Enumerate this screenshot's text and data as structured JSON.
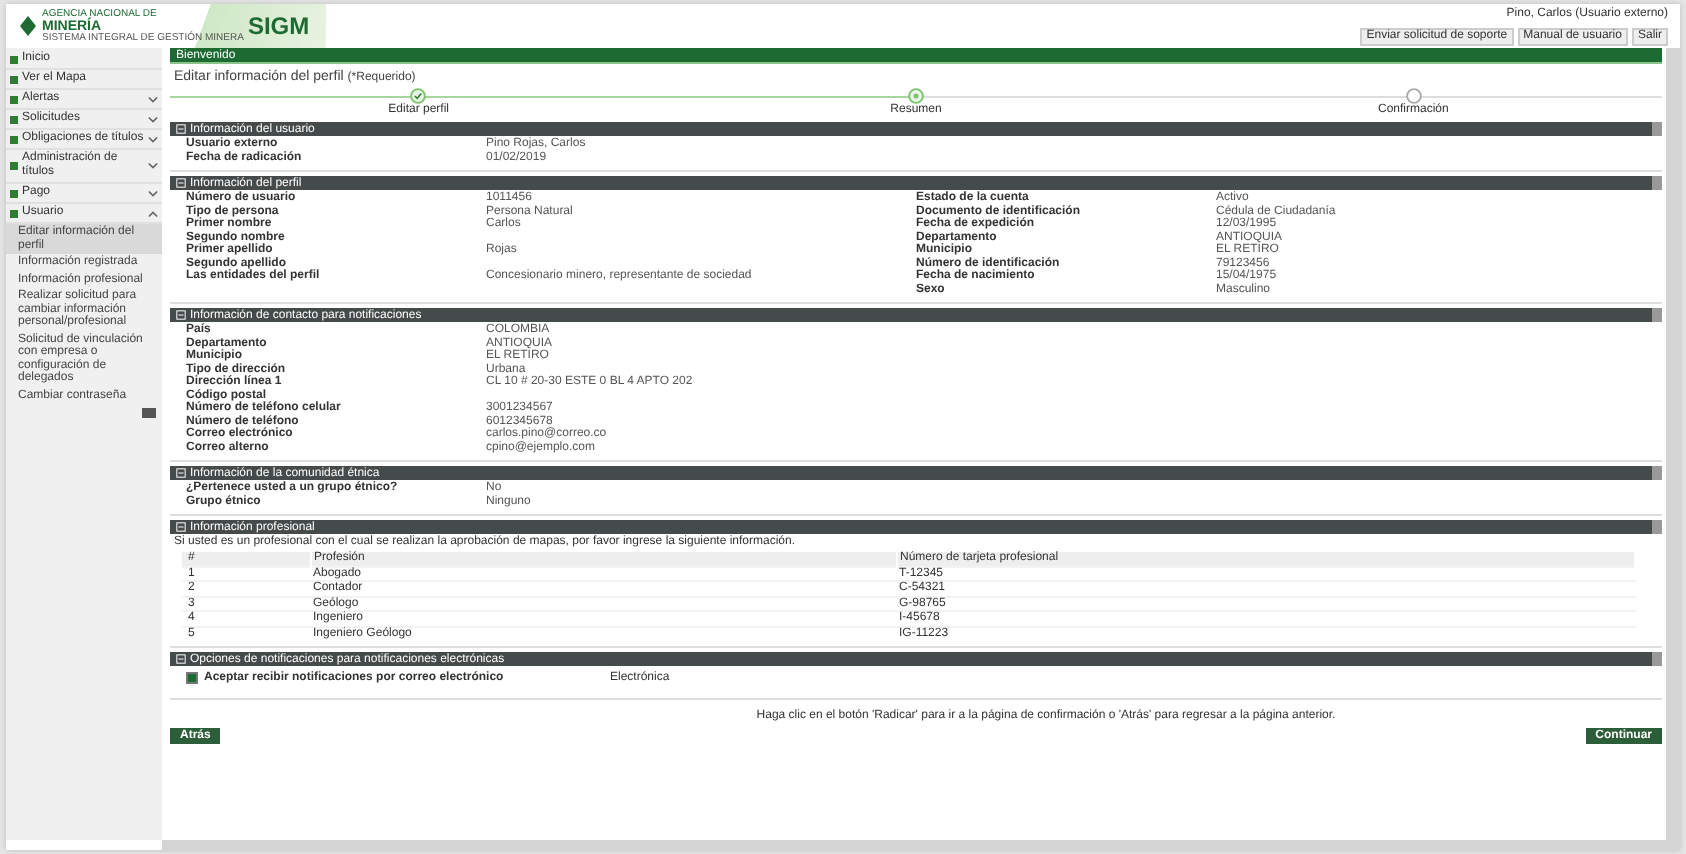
{
  "header": {
    "logo_top": "AGENCIA NACIONAL DE",
    "logo_main": "MINERÍA",
    "logo_brand": "SIGM",
    "logo_sub": "SISTEMA INTEGRAL DE GESTIÓN MINERA",
    "user": "Pino, Carlos (Usuario externo)",
    "buttons": [
      "Enviar solicitud de soporte",
      "Manual de usuario",
      "Salir"
    ]
  },
  "sidebar": {
    "items": [
      {
        "label": "Inicio",
        "kind": "link"
      },
      {
        "label": "Ver el Mapa",
        "kind": "link"
      },
      {
        "label": "Alertas",
        "kind": "menu",
        "expanded": false
      },
      {
        "label": "Solicitudes",
        "kind": "menu",
        "expanded": false
      },
      {
        "label": "Obligaciones de títulos",
        "kind": "menu",
        "expanded": false
      },
      {
        "label": "Administración de títulos",
        "kind": "menu",
        "expanded": false
      },
      {
        "label": "Pago",
        "kind": "menu",
        "expanded": false
      },
      {
        "label": "Usuario",
        "kind": "menu",
        "expanded": true,
        "children": [
          {
            "label": "Editar información del perfil",
            "selected": true
          },
          {
            "label": "Información registrada",
            "selected": false
          },
          {
            "label": "Información profesional",
            "selected": false
          },
          {
            "label": "Realizar solicitud para cambiar información personal/profesional",
            "selected": false
          },
          {
            "label": "Solicitud de vinculación con empresa o configuración de delegados",
            "selected": false
          },
          {
            "label": "Cambiar contraseña",
            "selected": false
          }
        ]
      }
    ]
  },
  "breadcrumb": "Bienvenido",
  "page": {
    "title": "Editar información del perfil",
    "required": "(*Requerido)"
  },
  "steps": [
    {
      "label": "Editar perfil",
      "completed": true,
      "selected": false
    },
    {
      "label": "Resumen",
      "completed": false,
      "selected": true
    },
    {
      "label": "Confirmación",
      "completed": false,
      "selected": false
    }
  ],
  "sections": [
    {
      "title": "Información del usuario",
      "kind": "fields",
      "left": [
        {
          "label": "Usuario externo",
          "value": "Pino Rojas, Carlos"
        },
        {
          "label": "Fecha de radicación",
          "value": "01/02/2019"
        }
      ]
    },
    {
      "title": "Información del perfil",
      "kind": "fields",
      "left": [
        {
          "label": "Número de usuario",
          "value": "1011456"
        },
        {
          "label": "Tipo de persona",
          "value": "Persona Natural"
        },
        {
          "label": "Primer nombre",
          "value": "Carlos"
        },
        {
          "label": "Segundo nombre"
        },
        {
          "label": "Primer apellido",
          "value": "Rojas"
        },
        {
          "label": "Segundo apellido"
        },
        {
          "label": "Las entidades del perfil",
          "value": "Concesionario minero, representante de sociedad"
        }
      ],
      "right": [
        {
          "label": "Estado de la cuenta",
          "value": "Activo"
        },
        {
          "label": "Documento de identificación",
          "value": "Cédula de Ciudadanía"
        },
        {
          "label": "Fecha de expedición",
          "value": "12/03/1995"
        },
        {
          "label": "Departamento",
          "value": "ANTIOQUIA"
        },
        {
          "label": "Municipio",
          "value": "EL RETIRO"
        },
        {
          "label": "Número de identificación",
          "value": "79123456"
        },
        {
          "label": "Fecha de nacimiento",
          "value": "15/04/1975"
        },
        {
          "label": "Sexo",
          "value": "Masculino"
        }
      ]
    },
    {
      "title": "Información de contacto para notificaciones",
      "kind": "fields",
      "left": [
        {
          "label": "País",
          "value": "COLOMBIA"
        },
        {
          "label": "Departamento",
          "value": "ANTIOQUIA"
        },
        {
          "label": "Municipio",
          "value": "EL RETIRO"
        },
        {
          "label": "Tipo de dirección",
          "value": "Urbana"
        },
        {
          "label": "Dirección línea 1",
          "value": "CL 10 # 20-30 ESTE 0 BL 4 APTO 202"
        },
        {
          "label": "Código postal"
        },
        {
          "label": "Número de teléfono celular",
          "value": "3001234567"
        },
        {
          "label": "Número de teléfono",
          "value": "6012345678"
        },
        {
          "label": "Correo electrónico",
          "value": "carlos.pino@correo.co"
        },
        {
          "label": "Correo alterno",
          "value": "cpino@ejemplo.com"
        }
      ]
    },
    {
      "title": "Información de la comunidad étnica",
      "kind": "fields",
      "left": [
        {
          "label": "¿Pertenece usted a un grupo étnico?",
          "value": "No"
        },
        {
          "label": "Grupo étnico",
          "value": "Ninguno"
        }
      ]
    },
    {
      "title": "Información profesional",
      "kind": "table",
      "intro": "Si usted es un profesional con el cual se realizan la aprobación de mapas, por favor ingrese la siguiente información.",
      "columns": [
        "#",
        "Profesión",
        "Número de tarjeta profesional"
      ],
      "rows": [
        [
          "1",
          "Abogado",
          "T-12345"
        ],
        [
          "2",
          "Contador",
          "C-54321"
        ],
        [
          "3",
          "Geólogo",
          "G-98765"
        ],
        [
          "4",
          "Ingeniero",
          "I-45678"
        ],
        [
          "5",
          "Ingeniero Geólogo",
          "IG-11223"
        ]
      ]
    },
    {
      "title": "Opciones de notificaciones para notificaciones electrónicas",
      "kind": "checkbox",
      "label": "Aceptar recibir notificaciones por correo electrónico",
      "checked": true,
      "value": "Electrónica"
    }
  ],
  "note": "Haga clic en el botón 'Radicar' para ir a la página de confirmación o 'Atrás' para regresar a la página anterior.",
  "back": "Atrás",
  "next": "Continuar"
}
